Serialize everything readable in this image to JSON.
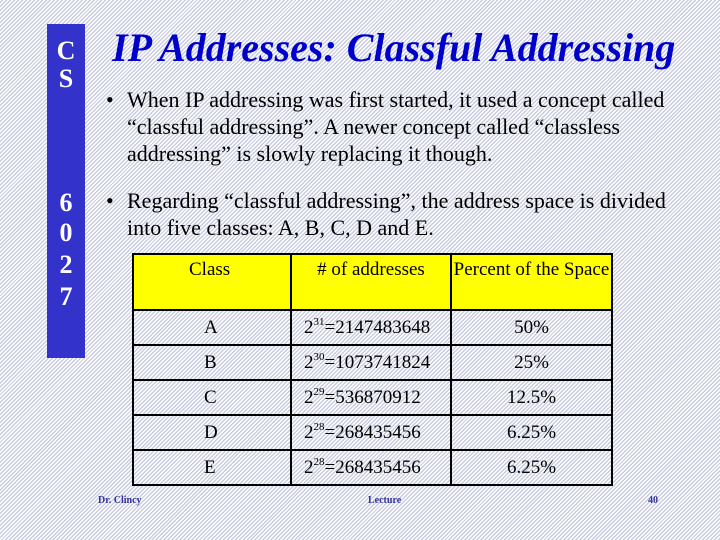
{
  "sidebar": {
    "chars": [
      "C",
      "S",
      "6",
      "0",
      "2",
      "7"
    ],
    "color": "#3333cc"
  },
  "title": "IP Addresses: Classful Addressing",
  "bullets": [
    {
      "symbol": "•",
      "text": "When IP addressing was first started, it used a concept called “classful addressing”.  A newer concept called “classless addressing” is slowly replacing it though."
    },
    {
      "symbol": "•",
      "text": "Regarding “classful addressing”, the address space is divided into five classes: A, B, C, D and E."
    }
  ],
  "table": {
    "headers": [
      "Class",
      "# of addresses",
      "Percent of the Space"
    ],
    "header_color": "#ffff00",
    "rows": [
      {
        "class": "A",
        "base": "2",
        "exp": "31",
        "count": "=2147483648",
        "percent": "50%"
      },
      {
        "class": "B",
        "base": "2",
        "exp": "30",
        "count": "=1073741824",
        "percent": "25%"
      },
      {
        "class": "C",
        "base": "2",
        "exp": "29",
        "count": "=536870912",
        "percent": "12.5%"
      },
      {
        "class": "D",
        "base": "2",
        "exp": "28",
        "count": "=268435456",
        "percent": "6.25%"
      },
      {
        "class": "E",
        "base": "2",
        "exp": "28",
        "count": "=268435456",
        "percent": "6.25%"
      }
    ]
  },
  "footer": {
    "author": "Dr. Clincy",
    "center": "Lecture",
    "page": "40"
  }
}
